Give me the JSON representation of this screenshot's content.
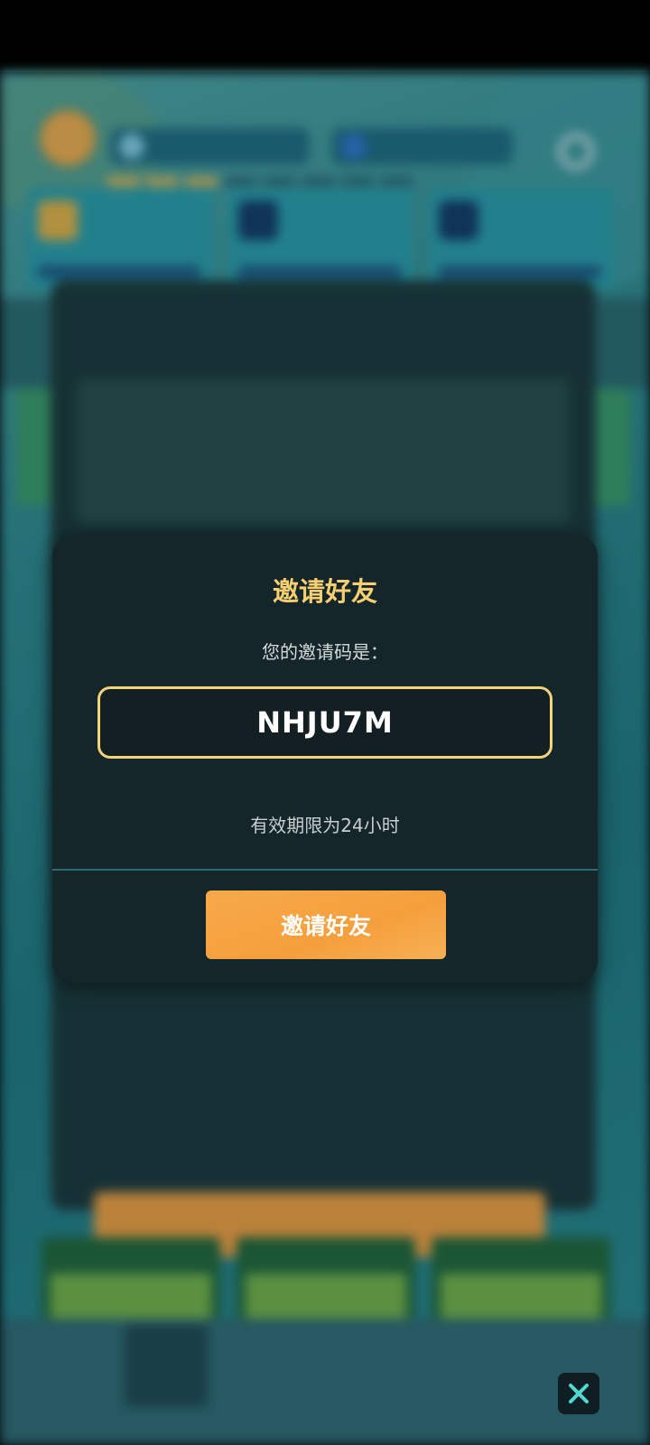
{
  "modal": {
    "title": "邀请好友",
    "subtitle": "您的邀请码是：",
    "invite_code": "NHJU7M",
    "expire_note": "有效期限为24小时",
    "button_label": "邀请好友"
  },
  "colors": {
    "accent_gold": "#f6cf71",
    "button_orange": "#f59f3c",
    "modal_bg": "#15262a",
    "close_icon": "#4fd9d0"
  },
  "icons": {
    "close": "close-icon",
    "settings": "gear-icon"
  }
}
